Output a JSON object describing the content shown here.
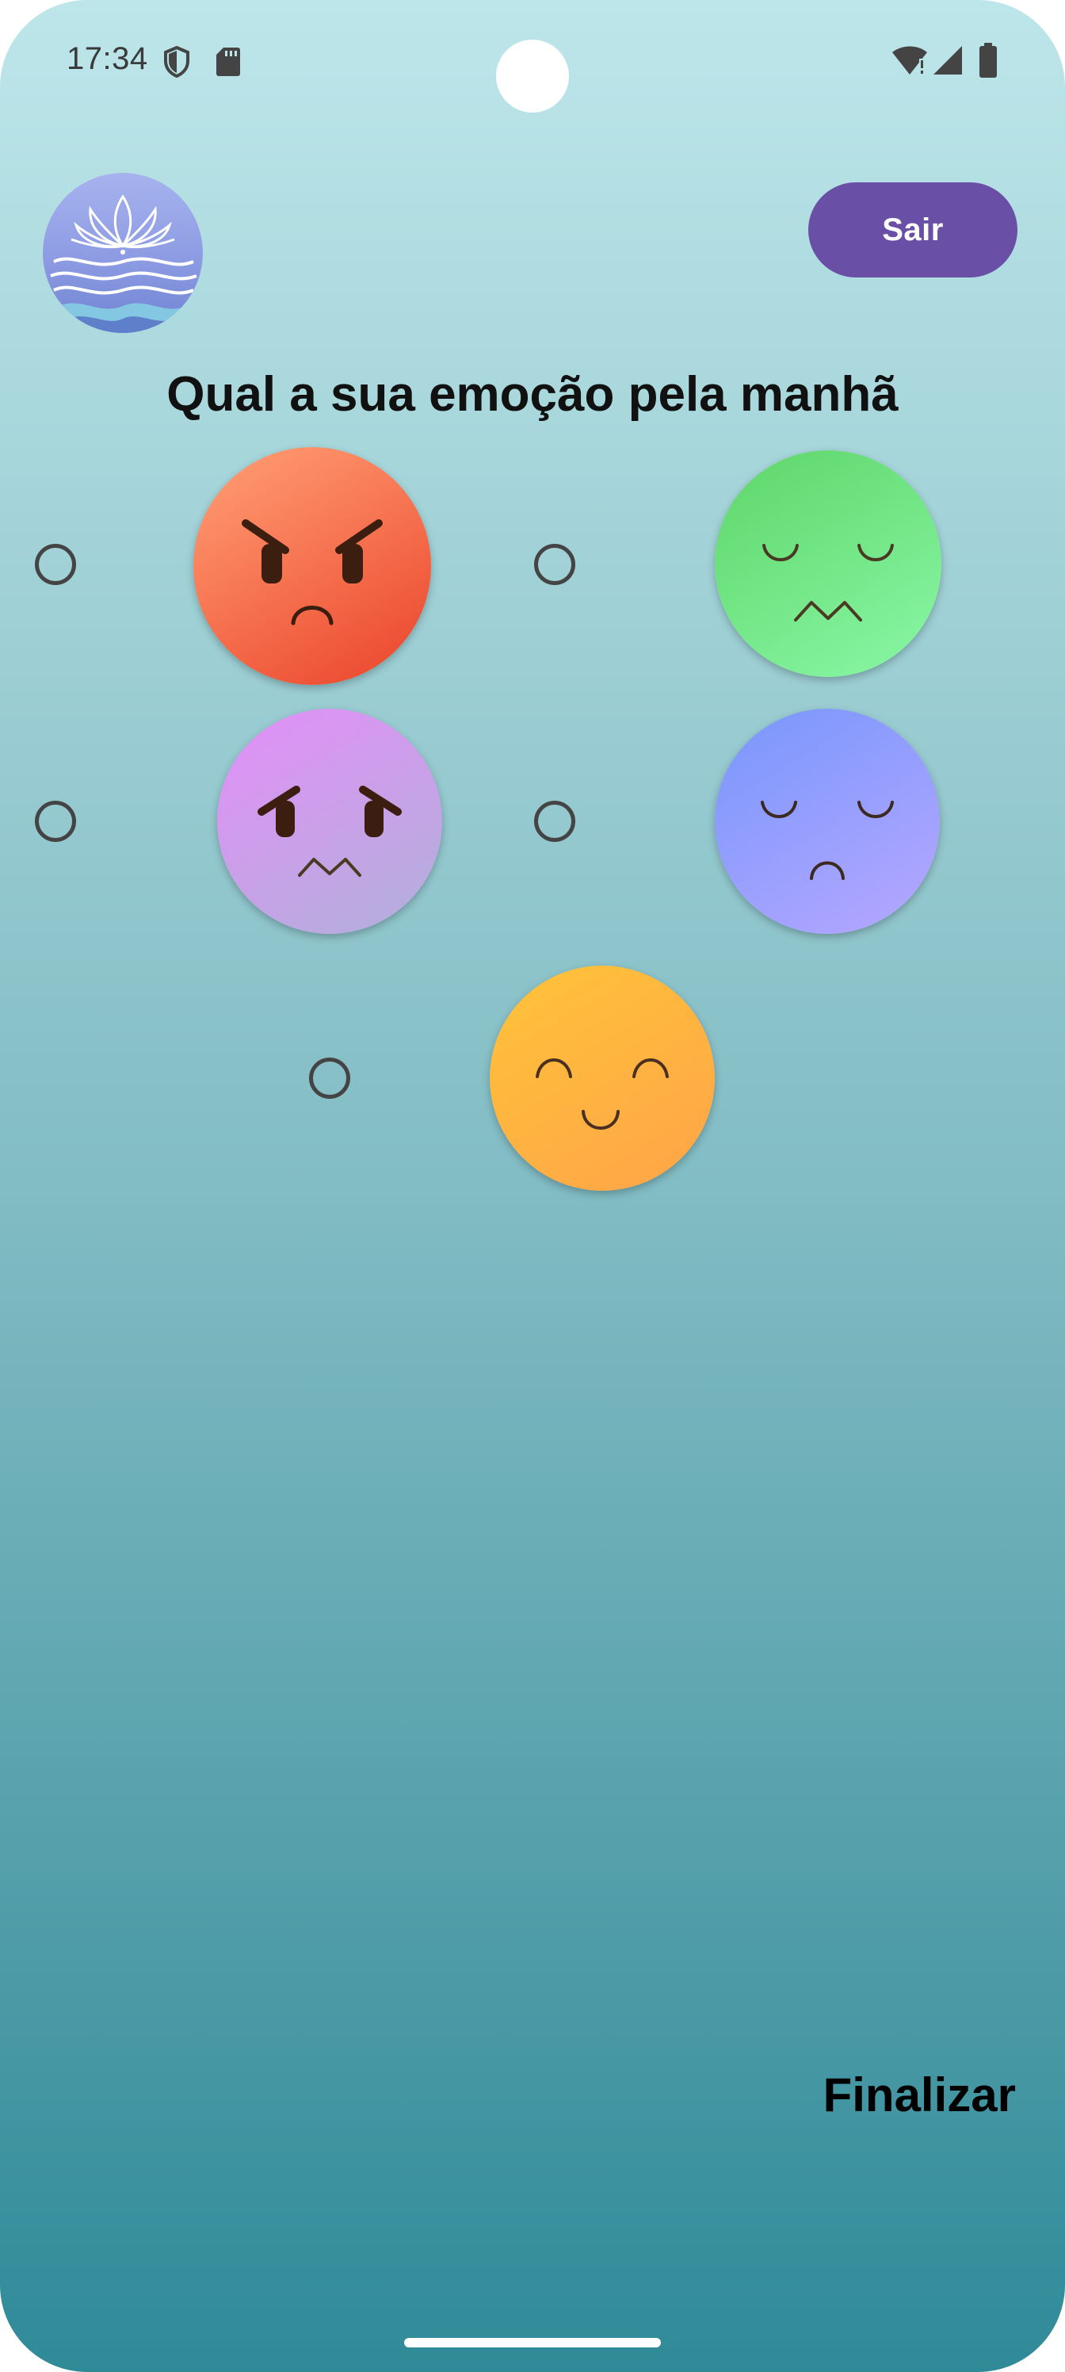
{
  "status_bar": {
    "time": "17:34",
    "icons": [
      "shield-icon",
      "sd-card-icon",
      "wifi-icon",
      "signal-icon",
      "battery-icon"
    ]
  },
  "header": {
    "logo": "lotus-waves-logo",
    "exit_label": "Sair",
    "exit_color": "#6a4fa6"
  },
  "question": "Qual a sua emoção pela manhã",
  "emotions": [
    {
      "face": "angry-face-icon",
      "color": "#f2603e",
      "selected": false
    },
    {
      "face": "disgusted-face-icon",
      "color": "#6fe27e",
      "selected": false
    },
    {
      "face": "fearful-face-icon",
      "color": "#d59bf0",
      "selected": false
    },
    {
      "face": "sad-face-icon",
      "color": "#8a9cff",
      "selected": false
    },
    {
      "face": "happy-face-icon",
      "color": "#ffb43c",
      "selected": false
    }
  ],
  "finish_label": "Finalizar"
}
